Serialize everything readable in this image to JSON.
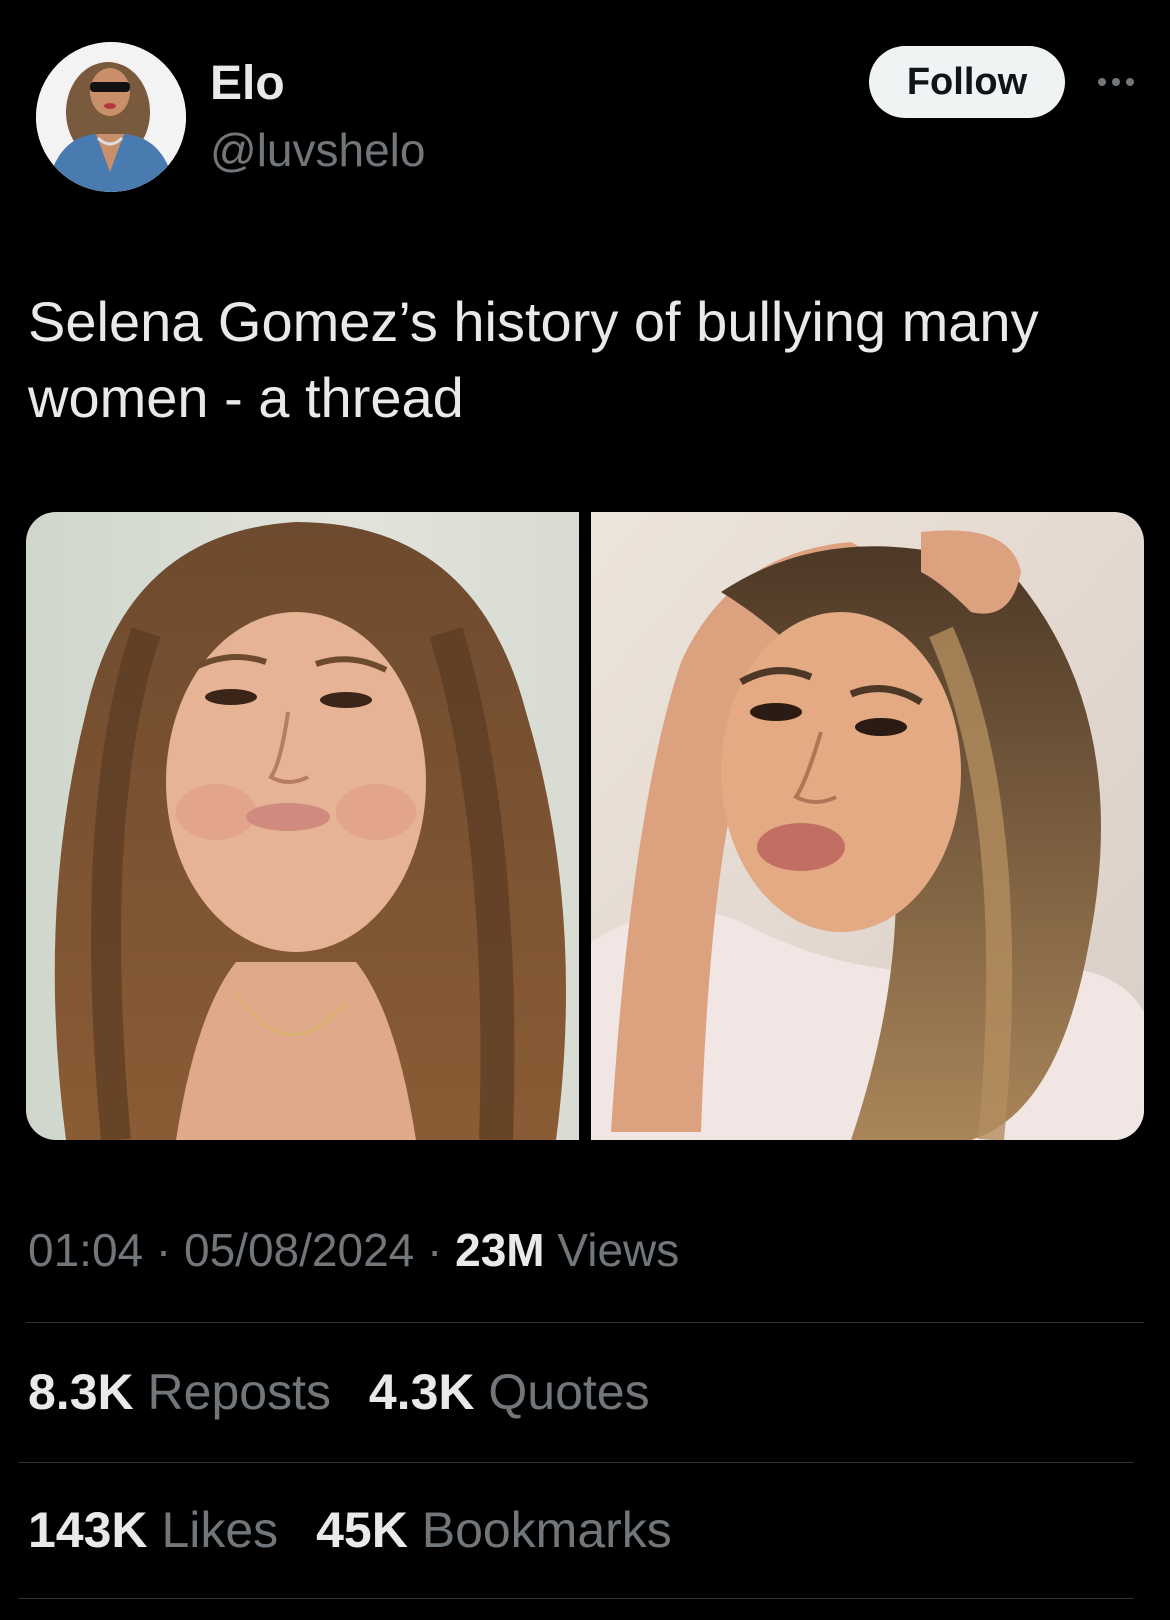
{
  "author": {
    "display_name": "Elo",
    "handle": "@luvshelo"
  },
  "header": {
    "follow_label": "Follow",
    "more_icon": "more-horizontal-icon"
  },
  "tweet": {
    "text": "Selena Gomez’s history of bullying many\nwomen - a thread"
  },
  "meta": {
    "time": "01:04",
    "separator": "·",
    "date": "05/08/2024",
    "views_count": "23M",
    "views_label": "Views"
  },
  "stats": {
    "reposts_count": "8.3K",
    "reposts_label": "Reposts",
    "quotes_count": "4.3K",
    "quotes_label": "Quotes",
    "likes_count": "143K",
    "likes_label": "Likes",
    "bookmarks_count": "45K",
    "bookmarks_label": "Bookmarks"
  },
  "colors": {
    "background": "#000000",
    "primary_text": "#e7e9ea",
    "secondary_text": "#71767b",
    "divider": "#2f3336",
    "follow_button_bg": "#eff3f4"
  }
}
